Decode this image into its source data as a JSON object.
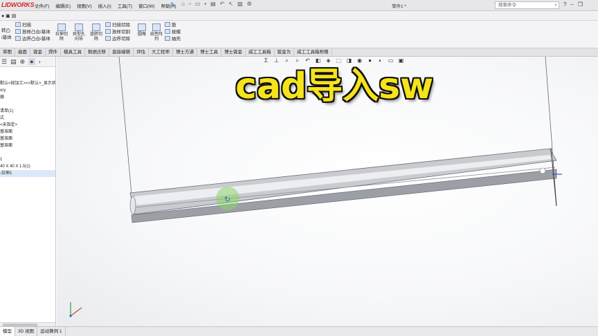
{
  "app": {
    "brand": "SOLIDWORKS",
    "brand_visible": "LIDWORKS",
    "menu": [
      "文件(F)",
      "编辑(E)",
      "视图(V)",
      "插入(I)",
      "工具(T)",
      "窗口(W)",
      "帮助(H)"
    ],
    "document_title": "零件1 *",
    "search_placeholder": "搜索命令"
  },
  "ribbon": {
    "left_group": [
      "扫描",
      "放样凸台/基体",
      "边界凸台/基体"
    ],
    "left_stub": [
      "转凸",
      "/基体"
    ],
    "cut_buttons": [
      "拉伸切除",
      "异型孔向导",
      "旋转切除"
    ],
    "cut_group": [
      "扫描切除",
      "放样切割",
      "边界切除"
    ],
    "fillet_buttons": [
      "圆角",
      "线性阵列"
    ],
    "features": [
      "筋",
      "拔模",
      "抽壳"
    ]
  },
  "tabs": [
    "草图",
    "曲面",
    "钣金",
    "焊件",
    "模具工具",
    "数据迁移",
    "直接编辑",
    "评估",
    "大工程师",
    "博士方通",
    "博士工具",
    "博士钣金",
    "威工工具箱",
    "钣金为",
    "威工工具箱附赠"
  ],
  "tree": {
    "items": [
      "默认<按加工><<默认>_显示状",
      "ory",
      "器",
      "",
      "清单(1)",
      "式",
      "<未指定>",
      "基准面",
      "基准面",
      "基准面",
      "",
      "1",
      "40 X 40 X 1.5(1)",
      "-拉伸1"
    ]
  },
  "overlay": {
    "title": "cad导入sw"
  },
  "bottom_tabs": [
    "模型",
    "3D 视图",
    "运动算例 1"
  ],
  "colors": {
    "accent_yellow": "#f5e31b",
    "brand_red": "#d6262a",
    "rotate_indicator": "#8bd66b",
    "selection_blue": "#dce8f8"
  }
}
